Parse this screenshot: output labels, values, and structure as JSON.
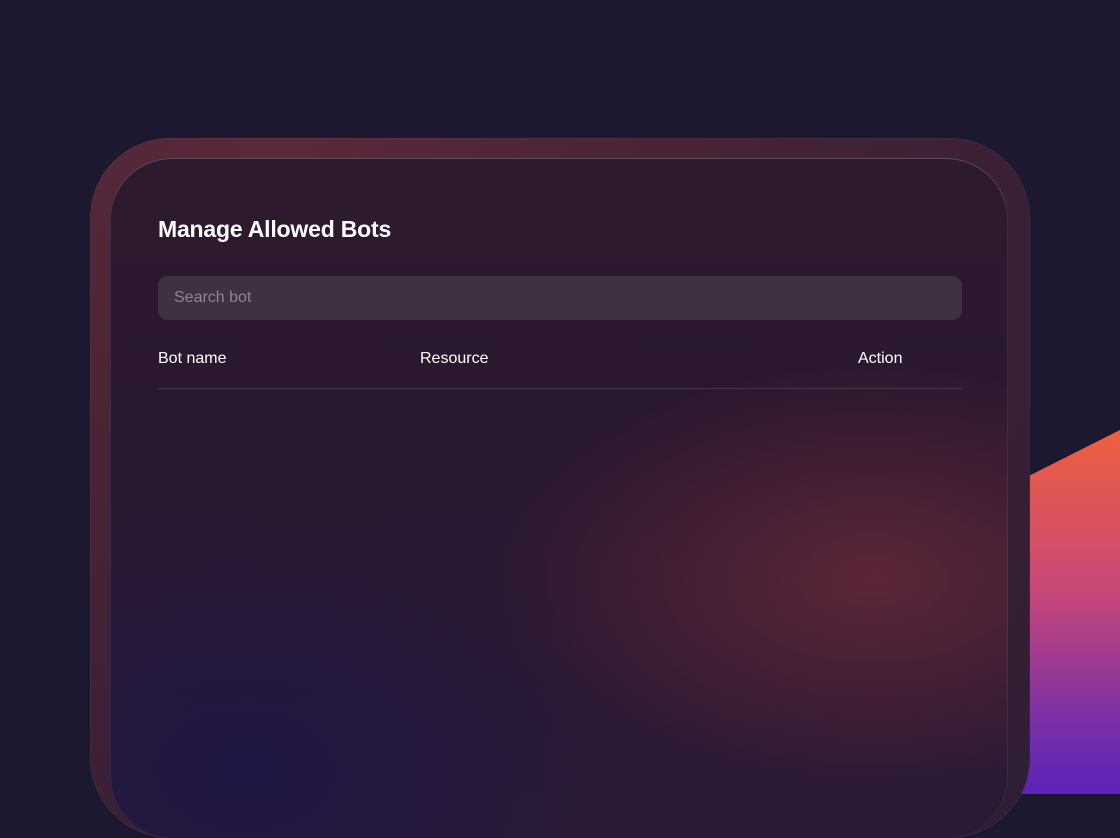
{
  "page": {
    "title": "Manage Allowed Bots"
  },
  "search": {
    "placeholder": "Search bot",
    "value": ""
  },
  "table": {
    "columns": [
      "Bot name",
      "Resource",
      "Action"
    ],
    "rows": []
  },
  "colors": {
    "background": "#1b1830",
    "panel": "#2a1830",
    "accent_top": "#f05f3e",
    "accent_bottom": "#5b23b8",
    "text": "#ffffff",
    "placeholder": "#8f8494"
  }
}
